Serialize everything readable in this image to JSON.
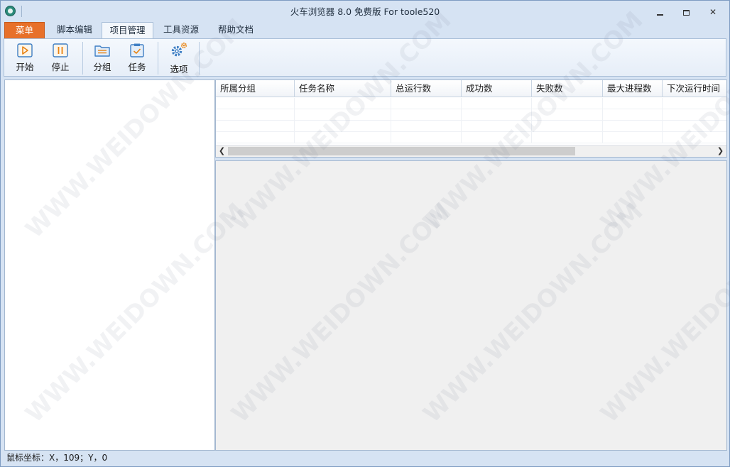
{
  "window": {
    "title": "火车浏览器 8.0 免费版 For toole520"
  },
  "tabs": {
    "menu": "菜单",
    "script_edit": "脚本编辑",
    "project_mgmt": "项目管理",
    "tools": "工具资源",
    "help": "帮助文档"
  },
  "ribbon": {
    "start": "开始",
    "stop": "停止",
    "group": "分组",
    "task": "任务",
    "options": "选项"
  },
  "grid": {
    "columns": [
      "所属分组",
      "任务名称",
      "总运行数",
      "成功数",
      "失败数",
      "最大进程数",
      "下次运行时间"
    ]
  },
  "statusbar": {
    "text": "鼠标坐标：X，109；Y，0"
  },
  "watermark": "WWW.WEIDOWN.COM",
  "colors": {
    "menu_tab": "#e7702a",
    "chrome": "#d6e3f3",
    "icon_orange": "#e8820f",
    "icon_blue": "#3f7fc4"
  }
}
